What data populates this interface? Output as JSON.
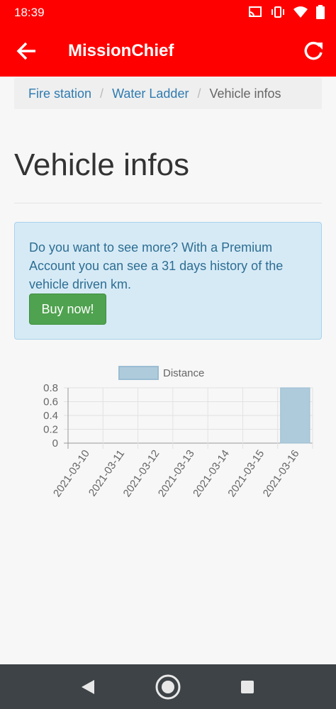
{
  "status_bar": {
    "time": "18:39",
    "icons": [
      "cast-icon",
      "vibrate-icon",
      "wifi-icon",
      "battery-icon"
    ]
  },
  "app_bar": {
    "title": "MissionChief",
    "back_icon": "arrow-left-icon",
    "refresh_icon": "refresh-icon"
  },
  "breadcrumb": {
    "items": [
      "Fire station",
      "Water Ladder",
      "Vehicle infos"
    ],
    "separator": "/"
  },
  "page": {
    "title": "Vehicle infos"
  },
  "alert": {
    "message": "Do you want to see more? With a Premium Account you can see a 31 days history of the vehicle driven km.",
    "button_label": "Buy now!"
  },
  "chart_data": {
    "type": "bar",
    "categories": [
      "2021-03-10",
      "2021-03-11",
      "2021-03-12",
      "2021-03-13",
      "2021-03-14",
      "2021-03-15",
      "2021-03-16"
    ],
    "series": [
      {
        "name": "Distance",
        "values": [
          0,
          0,
          0,
          0,
          0,
          0,
          0.8
        ]
      }
    ],
    "ylim": [
      0,
      0.8
    ],
    "yticks": [
      "0.8",
      "0.6",
      "0.4",
      "0.2",
      "0"
    ],
    "legend": "top",
    "grid": true,
    "colors": {
      "bar_fill": "#aecbdc",
      "bar_stroke": "#9bbdd2"
    }
  },
  "nav_bar": {
    "icons": [
      "back-triangle-icon",
      "home-circle-icon",
      "recents-square-icon"
    ]
  }
}
